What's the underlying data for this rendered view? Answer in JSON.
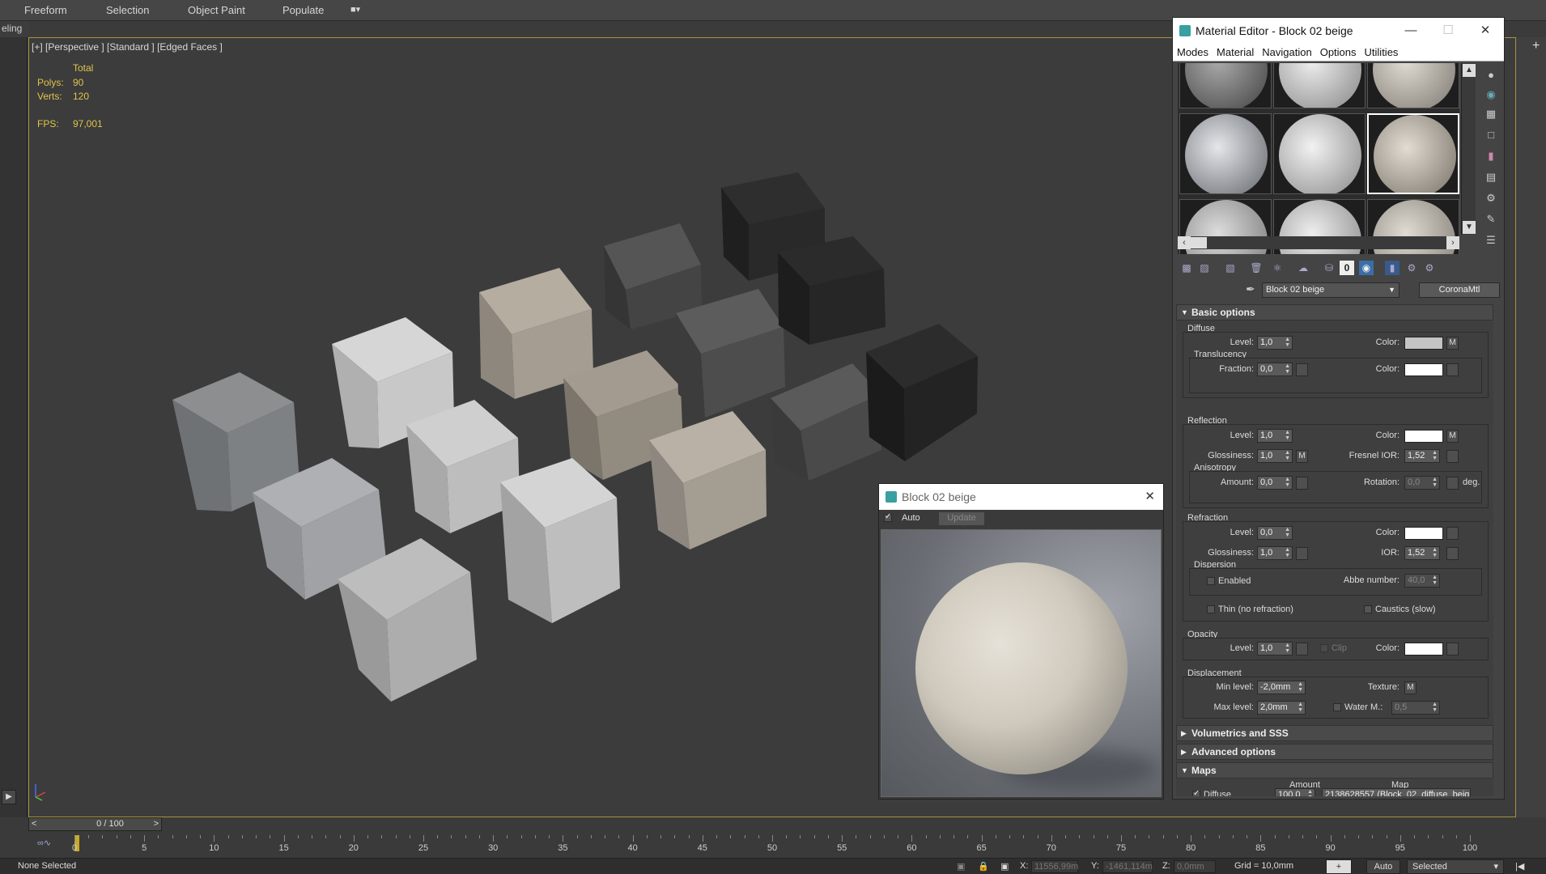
{
  "ribbon": {
    "tabs": [
      "Freeform",
      "Selection",
      "Object Paint",
      "Populate"
    ],
    "sub_label": "eling"
  },
  "viewport": {
    "label": "[+] [Perspective ] [Standard ] [Edged Faces ]",
    "stats": {
      "total_label": "Total",
      "polys_label": "Polys:",
      "polys": "90",
      "verts_label": "Verts:",
      "verts": "120",
      "fps_label": "FPS:",
      "fps": "97,001"
    }
  },
  "material_editor": {
    "title": "Material Editor - Block 02 beige",
    "menu": [
      "Modes",
      "Material",
      "Navigation",
      "Options",
      "Utilities"
    ],
    "material_name": "Block 02 beige",
    "material_type": "CoronaMtl",
    "basic_options": {
      "header": "Basic options",
      "diffuse": {
        "title": "Diffuse",
        "level_label": "Level:",
        "level": "1,0",
        "color_label": "Color:",
        "color": "#c4c4c4",
        "map_btn": "M",
        "translucency": {
          "title": "Translucency",
          "fraction_label": "Fraction:",
          "fraction": "0,0",
          "color_label": "Color:",
          "color": "#ffffff"
        }
      },
      "reflection": {
        "title": "Reflection",
        "level_label": "Level:",
        "level": "1,0",
        "color_label": "Color:",
        "color": "#ffffff",
        "map_btn": "M",
        "glossiness_label": "Glossiness:",
        "glossiness": "1,0",
        "gloss_map_btn": "M",
        "fresnel_label": "Fresnel IOR:",
        "fresnel": "1,52",
        "anisotropy": {
          "title": "Anisotropy",
          "amount_label": "Amount:",
          "amount": "0,0",
          "rotation_label": "Rotation:",
          "rotation": "0,0",
          "unit": "deg."
        }
      },
      "refraction": {
        "title": "Refraction",
        "level_label": "Level:",
        "level": "0,0",
        "color_label": "Color:",
        "color": "#ffffff",
        "glossiness_label": "Glossiness:",
        "glossiness": "1,0",
        "ior_label": "IOR:",
        "ior": "1,52",
        "dispersion": {
          "title": "Dispersion",
          "enabled_label": "Enabled",
          "abbe_label": "Abbe number:",
          "abbe": "40,0"
        },
        "thin_label": "Thin (no refraction)",
        "caustics_label": "Caustics (slow)"
      },
      "opacity": {
        "title": "Opacity",
        "level_label": "Level:",
        "level": "1,0",
        "clip_label": "Clip",
        "color_label": "Color:",
        "color": "#ffffff"
      },
      "displacement": {
        "title": "Displacement",
        "min_label": "Min level:",
        "min": "-2,0mm",
        "texture_label": "Texture:",
        "texture_btn": "M",
        "max_label": "Max level:",
        "max": "2,0mm",
        "water_label": "Water M.:",
        "water": "0,5"
      }
    },
    "rollouts": {
      "volumetrics": "Volumetrics and SSS",
      "advanced": "Advanced options",
      "maps": "Maps"
    },
    "maps": {
      "amount_header": "Amount",
      "map_header": "Map",
      "diffuse_label": "Diffuse",
      "diffuse_amount": "100,0",
      "diffuse_map": "2138628557 (Block_02_diffuse_beig"
    }
  },
  "preview": {
    "title": "Block 02 beige",
    "auto_label": "Auto",
    "update_label": "Update"
  },
  "timeline": {
    "frame_display": "0 / 100",
    "ticks": [
      "0",
      "5",
      "10",
      "15",
      "20",
      "25",
      "30",
      "35",
      "40",
      "45",
      "50",
      "55",
      "60",
      "65",
      "70",
      "75",
      "80",
      "85",
      "90",
      "95",
      "100"
    ]
  },
  "status": {
    "selection": "None Selected",
    "x_label": "X:",
    "x": "11556,99m",
    "y_label": "Y:",
    "y": "-1461,114m",
    "z_label": "Z:",
    "z": "0,0mm",
    "grid": "Grid = 10,0mm",
    "auto_btn": "Auto",
    "selected_dd": "Selected"
  }
}
